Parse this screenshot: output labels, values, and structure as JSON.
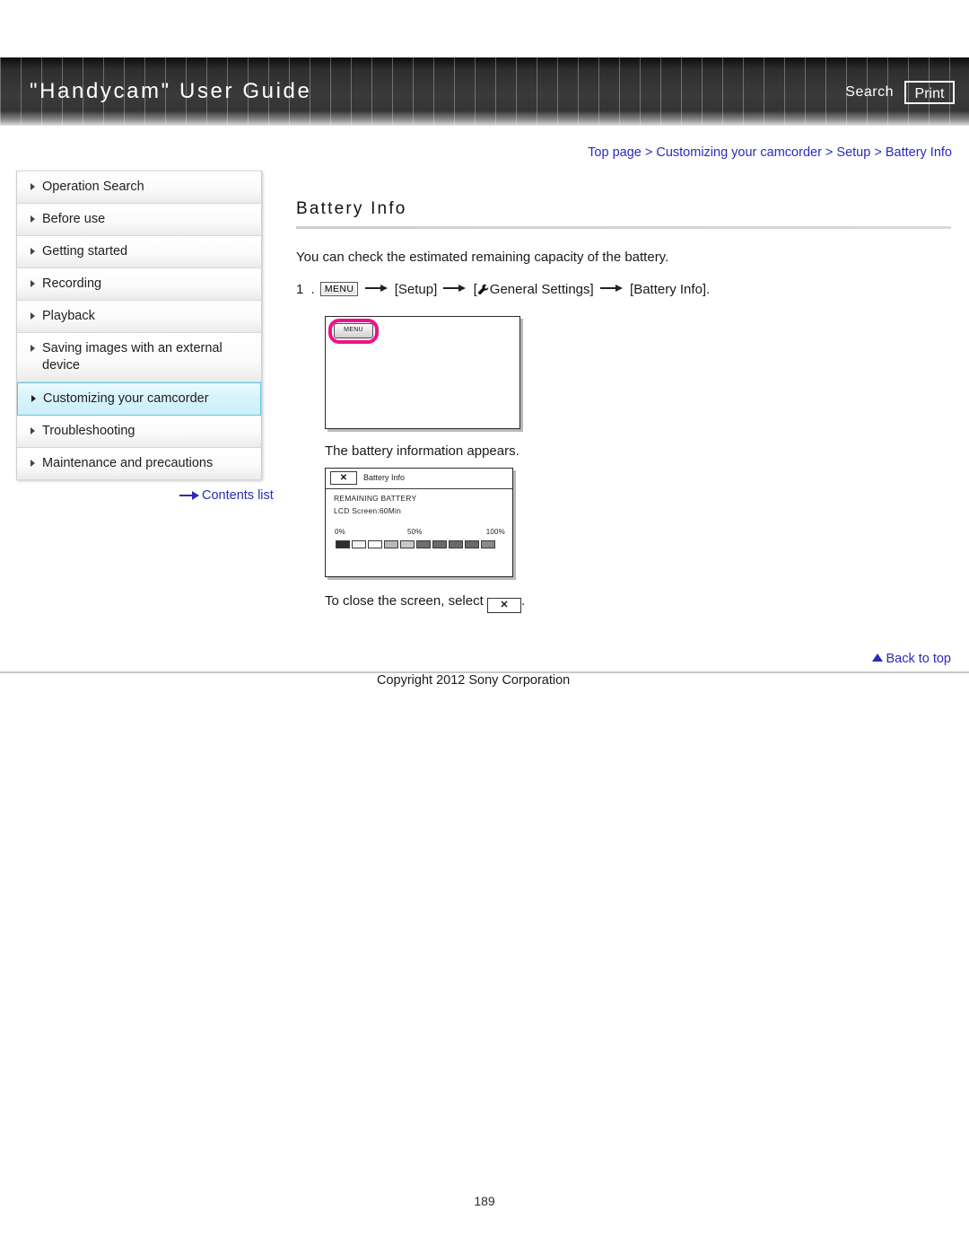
{
  "header": {
    "title": "\"Handycam\" User Guide",
    "search_label": "Search",
    "print_label": "Print"
  },
  "breadcrumb": {
    "text": "Top page > Customizing your camcorder > Setup > Battery Info"
  },
  "sidebar": {
    "items": [
      {
        "label": "Operation Search",
        "selected": false
      },
      {
        "label": "Before use",
        "selected": false
      },
      {
        "label": "Getting started",
        "selected": false
      },
      {
        "label": "Recording",
        "selected": false
      },
      {
        "label": "Playback",
        "selected": false
      },
      {
        "label": "Saving images with an external device",
        "selected": false
      },
      {
        "label": "Customizing your camcorder",
        "selected": true
      },
      {
        "label": "Troubleshooting",
        "selected": false
      },
      {
        "label": "Maintenance and precautions",
        "selected": false
      }
    ],
    "contents_list_label": "Contents list"
  },
  "main": {
    "title": "Battery Info",
    "intro": "You can check the estimated remaining capacity of the battery.",
    "step": {
      "number": "1 .",
      "menu_chip": "MENU",
      "part1": "[Setup]",
      "part2": "General Settings]",
      "part2_open": "[",
      "part3": "[Battery Info]."
    },
    "figure1": {
      "menu_button_label": "MENU",
      "highlight_color": "#ee1289"
    },
    "caption": "The battery information appears.",
    "figure2": {
      "close_icon": "✕",
      "title": "Battery Info",
      "line1": "REMAINING BATTERY",
      "line2": "LCD Screen:60Min",
      "scale_0": "0%",
      "scale_50": "50%",
      "scale_100": "100%",
      "segments": [
        "#2e2e2e",
        "#f2f2f2",
        "#ffffff",
        "#b8b8b8",
        "#c8c8c8",
        "#6e6e6e",
        "#6a6a6a",
        "#6a6a6a",
        "#6a6a6a",
        "#8a8a8a"
      ]
    },
    "close_note_prefix": "To close the screen, select",
    "close_note_icon": "✕",
    "close_note_suffix": "."
  },
  "footer": {
    "back_to_top": "Back to top",
    "copyright": "Copyright 2012 Sony Corporation",
    "page_number": "189"
  },
  "colors": {
    "link": "#2b2bbb",
    "selected_nav_border": "#5fc8e0",
    "highlight_pink": "#ee1289"
  }
}
